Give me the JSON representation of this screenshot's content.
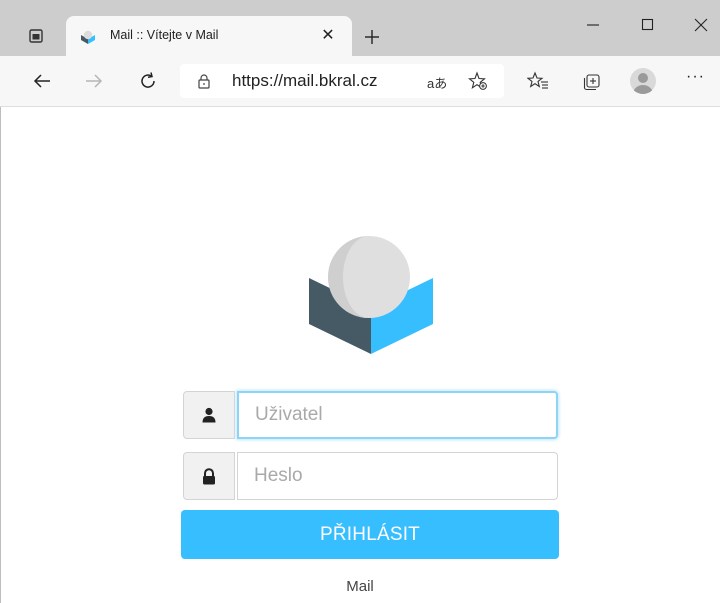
{
  "browser": {
    "tab_title": "Mail :: Vítejte v Mail",
    "tab_close_glyph": "✕",
    "new_tab_label": "new-tab",
    "url": "https://mail.bkral.cz",
    "read_aloud": "aあ",
    "more_glyph": "···",
    "window_buttons": [
      "minimize",
      "maximize",
      "close"
    ]
  },
  "login": {
    "username_placeholder": "Uživatel",
    "password_placeholder": "Heslo",
    "submit_label": "PŘIHLÁSIT",
    "footer": "Mail"
  },
  "colors": {
    "accent": "#37beff",
    "logo_dark": "#455a64",
    "logo_blue": "#37beff",
    "logo_sphere": "#dfdfdf"
  },
  "icons": {
    "username": "user-icon",
    "password": "lock-icon"
  }
}
